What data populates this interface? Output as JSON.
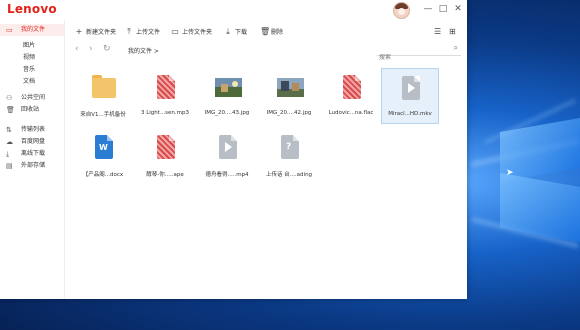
{
  "app": {
    "logo": "Lenovo"
  },
  "window_controls": [
    "—",
    "□",
    "✕"
  ],
  "sidebar": {
    "items": [
      {
        "label": "我的文件",
        "icon": "folder-icon",
        "active": true,
        "sub": false
      },
      {
        "label": "图片",
        "icon": "",
        "active": false,
        "sub": true
      },
      {
        "label": "视频",
        "icon": "",
        "active": false,
        "sub": true
      },
      {
        "label": "音乐",
        "icon": "",
        "active": false,
        "sub": true
      },
      {
        "label": "文档",
        "icon": "",
        "active": false,
        "sub": true
      },
      {
        "label": "公共空间",
        "icon": "users-icon",
        "active": false,
        "sub": false
      },
      {
        "label": "回收站",
        "icon": "trash-icon",
        "active": false,
        "sub": false
      },
      {
        "label": "传输列表",
        "icon": "transfer-icon",
        "active": false,
        "sub": false
      },
      {
        "label": "百度网盘",
        "icon": "cloud-icon",
        "active": false,
        "sub": false
      },
      {
        "label": "离线下载",
        "icon": "download-icon",
        "active": false,
        "sub": false
      },
      {
        "label": "外部存储",
        "icon": "storage-icon",
        "active": false,
        "sub": false
      }
    ]
  },
  "toolbar": {
    "new_folder": "新建文件夹",
    "upload_file": "上传文件",
    "upload_folder": "上传文件夹",
    "download": "下载",
    "delete": "删除"
  },
  "breadcrumb": {
    "path": "我的文件 >"
  },
  "search": {
    "placeholder": "搜索"
  },
  "files": [
    {
      "name": "来自V1...手机备份",
      "type": "folder",
      "selected": false
    },
    {
      "name": "3 Light...sen.mp3",
      "type": "audio",
      "selected": false
    },
    {
      "name": "IMG_20....43.jpg",
      "type": "photo",
      "selected": false
    },
    {
      "name": "IMG_20....42.jpg",
      "type": "photo2",
      "selected": false
    },
    {
      "name": "Ludovic...na.flac",
      "type": "audio",
      "selected": false
    },
    {
      "name": "Miracl...HD.mkv",
      "type": "video",
      "selected": true
    },
    {
      "name": "【产品阁...docx",
      "type": "word",
      "selected": false
    },
    {
      "name": "酵琴-你.....ape",
      "type": "audio",
      "selected": false
    },
    {
      "name": "德舟看得.....mp4",
      "type": "video",
      "selected": false
    },
    {
      "name": "上传话 台....ading",
      "type": "unknown",
      "selected": false
    }
  ],
  "colors": {
    "brand": "#e3231a",
    "folder": "#f4c46a",
    "audio": "#d74b4b",
    "word": "#2b7cd3",
    "grey_doc": "#b8bec6",
    "selected_bg": "#e6f0fb"
  }
}
